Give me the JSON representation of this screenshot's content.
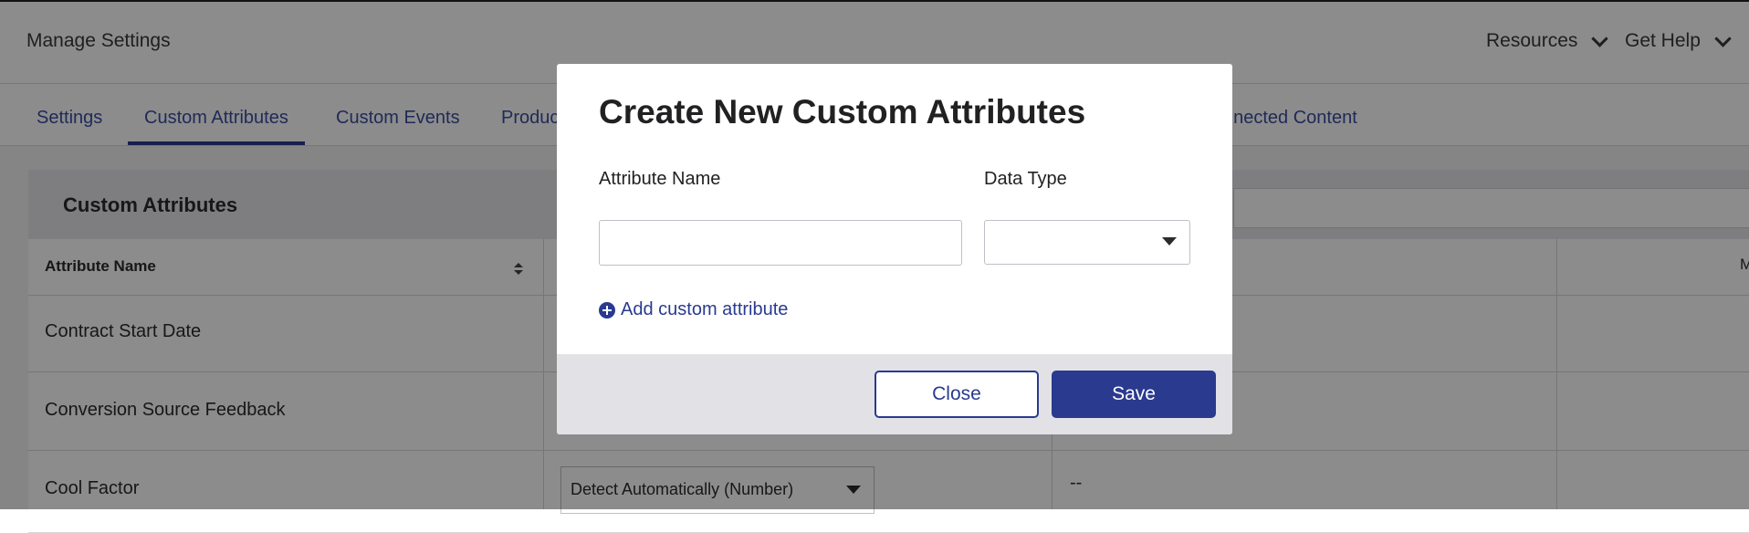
{
  "header": {
    "title": "Manage Settings",
    "nav": [
      {
        "label": "Resources"
      },
      {
        "label": "Get Help"
      }
    ]
  },
  "tabs": [
    {
      "label": "Settings",
      "active": false
    },
    {
      "label": "Custom Attributes",
      "active": true
    },
    {
      "label": "Custom Events",
      "active": false
    },
    {
      "label": "Produc",
      "active": false
    },
    {
      "label": "nnected Content",
      "active": false
    }
  ],
  "panel": {
    "title": "Custom Attributes",
    "columns": [
      {
        "label": "Attribute Name"
      },
      {
        "label": "M"
      }
    ],
    "rows": [
      {
        "name": "Contract Start Date",
        "data_type": "",
        "value": ""
      },
      {
        "name": "Conversion Source Feedback",
        "data_type": "",
        "value": ""
      },
      {
        "name": "Cool Factor",
        "data_type": "Detect Automatically (Number)",
        "value": "--"
      }
    ]
  },
  "modal": {
    "title": "Create New Custom Attributes",
    "attribute_name_label": "Attribute Name",
    "attribute_name_value": "",
    "data_type_label": "Data Type",
    "data_type_value": "",
    "add_link": "Add custom attribute",
    "close_label": "Close",
    "save_label": "Save"
  }
}
